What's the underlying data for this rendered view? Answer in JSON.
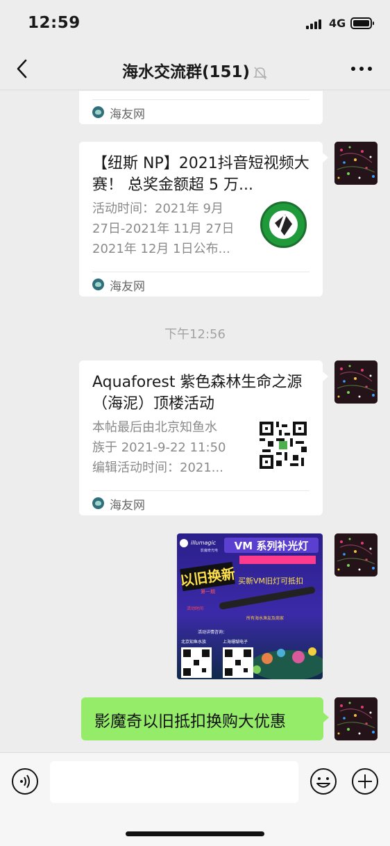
{
  "status_bar": {
    "time": "12:59",
    "network": "4G"
  },
  "header": {
    "title": "海水交流群(151)"
  },
  "messages": {
    "card_partial": {
      "source": "海友网"
    },
    "card_1": {
      "title": "【纽斯 NP】2021抖音短视频大赛！ 总奖金额超 5 万...",
      "desc": [
        "活动时间：2021年 9月",
        "27日-2021年 11月 27日",
        "2021年 12月 1日公布..."
      ],
      "source": "海友网"
    },
    "timestamp": "下午12:56",
    "card_2": {
      "title": "Aquaforest 紫色森林生命之源（海泥）顶楼活动",
      "desc": [
        "本帖最后由北京知鱼水",
        "族于 2021-9-22 11:50",
        "编辑活动时间：2021..."
      ],
      "source": "海友网"
    },
    "poster": {
      "brand": "illumagic",
      "brand_sub": "影魔奇光电",
      "headline": "VM 系列补光灯",
      "banner": "以旧换新",
      "sub_tag": "第一期",
      "trade_in": "买新VM旧灯可抵扣",
      "event_label": "活动时间",
      "audience": "所有海水渔友及商家",
      "inquiry": "活动详情咨询：",
      "dealer_1": "北京知鱼水族",
      "dealer_2": "上海珊瑚电子"
    },
    "text_message": "影魔奇以旧抵扣换购大优惠"
  },
  "input": {
    "value": ""
  },
  "colors": {
    "bubble_green": "#95ec69",
    "background": "#ededed",
    "card": "#ffffff",
    "meta_gray": "#8a8a8a"
  },
  "icons": [
    "back-icon",
    "mute-icon",
    "more-icon",
    "voice-icon",
    "emoji-icon",
    "plus-icon"
  ]
}
